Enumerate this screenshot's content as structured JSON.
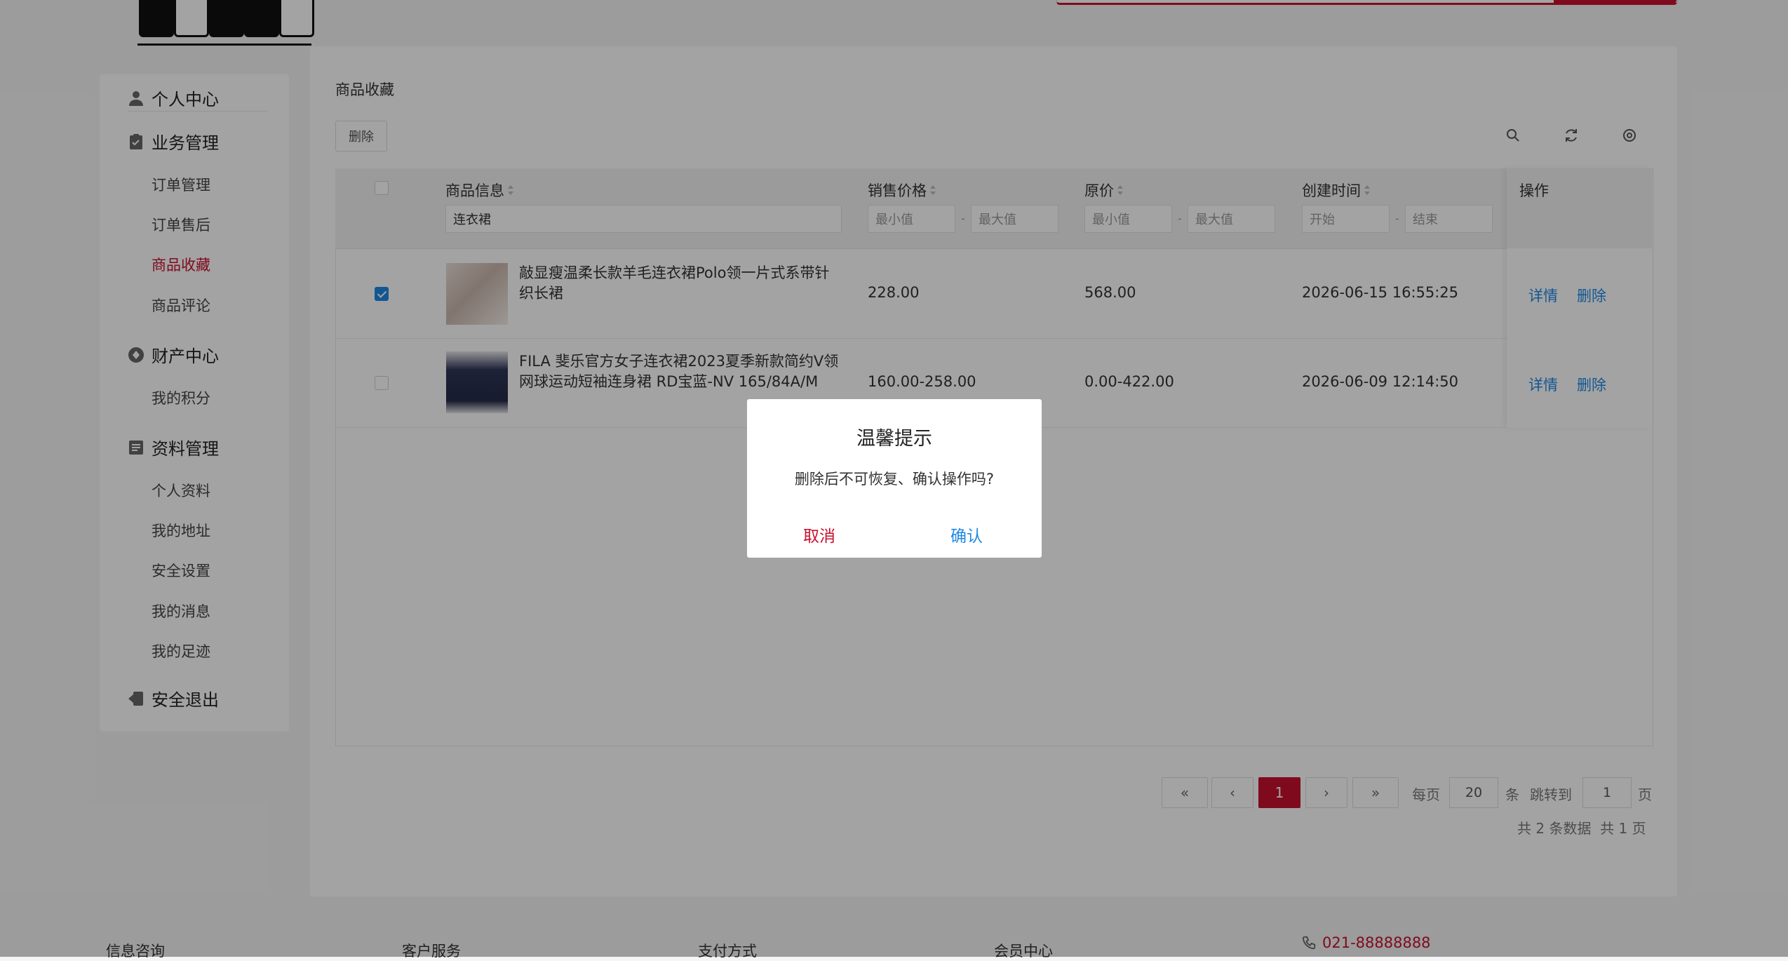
{
  "sidebar": {
    "sections": [
      {
        "label": "个人中心",
        "icon": "user-icon",
        "items": []
      },
      {
        "label": "业务管理",
        "icon": "clipboard-check-icon",
        "items": [
          "订单管理",
          "订单售后",
          "商品收藏",
          "商品评论"
        ]
      },
      {
        "label": "财产中心",
        "icon": "coin-icon",
        "items": [
          "我的积分"
        ]
      },
      {
        "label": "资料管理",
        "icon": "profile-card-icon",
        "items": [
          "个人资料",
          "我的地址",
          "安全设置",
          "我的消息",
          "我的足迹"
        ]
      },
      {
        "label": "安全退出",
        "icon": "logout-icon",
        "items": []
      }
    ],
    "active_item": "商品收藏"
  },
  "main": {
    "title": "商品收藏",
    "delete_button": "删除",
    "toolbar_icons": [
      "search-icon",
      "refresh-icon",
      "settings-icon"
    ]
  },
  "table": {
    "headers": {
      "product": "商品信息",
      "price": "销售价格",
      "original": "原价",
      "created": "创建时间",
      "actions": "操作"
    },
    "filters": {
      "product_value": "连衣裙",
      "price_min_placeholder": "最小值",
      "price_max_placeholder": "最大值",
      "original_min_placeholder": "最小值",
      "original_max_placeholder": "最大值",
      "date_start_placeholder": "开始",
      "date_end_placeholder": "结束",
      "separator": "-"
    },
    "rows": [
      {
        "checked": true,
        "title": "敲显瘦温柔长款羊毛连衣裙Polo领一片式系带针织长裙",
        "price": "228.00",
        "original": "568.00",
        "created": "2026-06-15 16:55:25",
        "detail": "详情",
        "delete": "删除"
      },
      {
        "checked": false,
        "title": "FILA 斐乐官方女子连衣裙2023夏季新款简约V领网球运动短袖连身裙 RD宝蓝-NV 165/84A/M",
        "price": "160.00-258.00",
        "original": "0.00-422.00",
        "created": "2026-06-09 12:14:50",
        "detail": "详情",
        "delete": "删除"
      }
    ]
  },
  "pagination": {
    "first": "«",
    "prev": "‹",
    "current": "1",
    "next": "›",
    "last": "»",
    "per_page_label": "每页",
    "per_page": "20",
    "per_page_unit": "条",
    "jump_label": "跳转到",
    "jump_value": "1",
    "page_unit": "页",
    "total_records": "共 2 条数据",
    "total_pages": "共 1 页"
  },
  "footer": {
    "columns": [
      "信息咨询",
      "客户服务",
      "支付方式",
      "会员中心"
    ],
    "phone": "021-88888888"
  },
  "dialog": {
    "title": "温馨提示",
    "message": "删除后不可恢复、确认操作吗?",
    "cancel": "取消",
    "confirm": "确认"
  },
  "colors": {
    "brand_red": "#c8102e",
    "link_blue": "#1e88e5",
    "overlay": "rgba(0,0,0,0.36)"
  }
}
